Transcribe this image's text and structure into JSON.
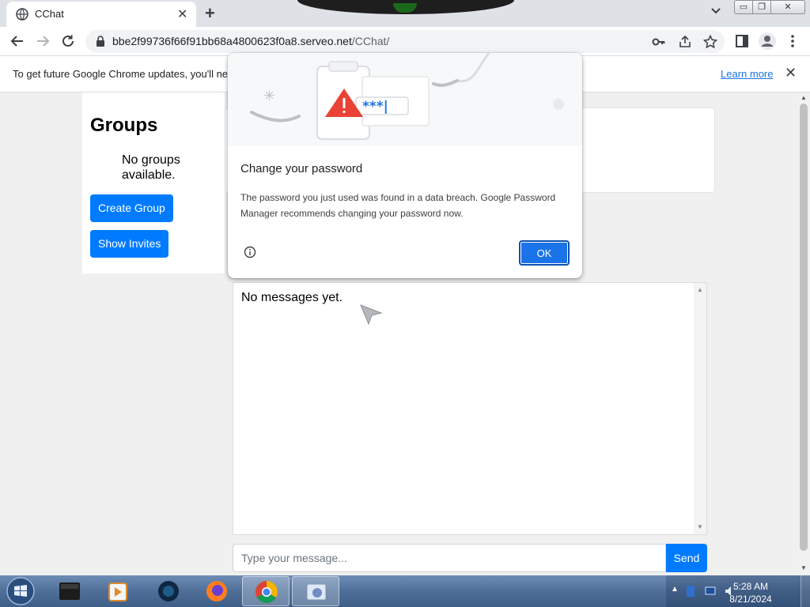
{
  "browser": {
    "tab_title": "CChat",
    "url_host": "bbe2f99736f66f91bb68a4800623f0a8.serveo.net",
    "url_path": "/CChat/",
    "window_buttons": {
      "minimize": "▭",
      "maximize": "❐",
      "close": "✕"
    }
  },
  "infobar": {
    "text": "To get future Google Chrome updates, you'll ne",
    "link": "Learn more",
    "close": "✕"
  },
  "sidebar": {
    "title": "Groups",
    "empty_text": "No groups available.",
    "create_button": "Create Group",
    "invites_button": "Show Invites"
  },
  "main": {
    "messages_empty": "No messages yet.",
    "input_placeholder": "Type your message...",
    "send_button": "Send"
  },
  "dialog": {
    "title": "Change your password",
    "body": "The password you just used was found in a data breach. Google Password Manager recommends changing your password now.",
    "ok_button": "OK",
    "password_mask": "***|"
  },
  "taskbar": {
    "time": "5:28 AM",
    "date": "8/21/2024"
  },
  "colors": {
    "accent": "#007bff",
    "chrome_blue": "#1a73e8",
    "warning_red": "#ea4335"
  }
}
